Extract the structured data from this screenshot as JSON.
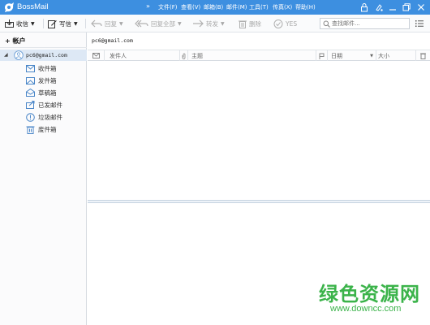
{
  "app": {
    "title": "BossMail"
  },
  "menu": {
    "chevron": "»",
    "items": [
      "文件(F)",
      "查看(V)",
      "邮箱(B)",
      "邮件(M)",
      "工具(T)",
      "传真(X)",
      "帮助(H)"
    ]
  },
  "window_icons": [
    "lock-icon",
    "theme-icon",
    "minimize-icon",
    "restore-icon",
    "close-icon"
  ],
  "toolbar": {
    "inbox": "收信",
    "compose": "写信",
    "reply": "回复",
    "reply_all": "回复全部",
    "forward": "转发",
    "delete": "删除",
    "yes": "YES"
  },
  "search": {
    "placeholder": "查找邮件..."
  },
  "sidebar": {
    "add_account": "帐户",
    "account": "pc6@gmail.com",
    "folders": [
      {
        "label": "收件箱",
        "icon": "inbox-icon"
      },
      {
        "label": "发件箱",
        "icon": "outbox-icon"
      },
      {
        "label": "草稿箱",
        "icon": "drafts-icon"
      },
      {
        "label": "已发邮件",
        "icon": "sent-icon"
      },
      {
        "label": "垃圾邮件",
        "icon": "spam-icon"
      },
      {
        "label": "废件箱",
        "icon": "trash-icon"
      }
    ]
  },
  "mail_list": {
    "mailbox": "pc6@gmail.com",
    "columns": {
      "sender": "发件人",
      "subject": "主题",
      "date": "日期",
      "size": "大小"
    }
  },
  "watermark": {
    "title": "绿色资源网",
    "url": "www.downcc.com"
  },
  "colors": {
    "titlebar": "#3d8fe0",
    "selection": "#dde8f5",
    "watermark": "#3bb34a"
  }
}
